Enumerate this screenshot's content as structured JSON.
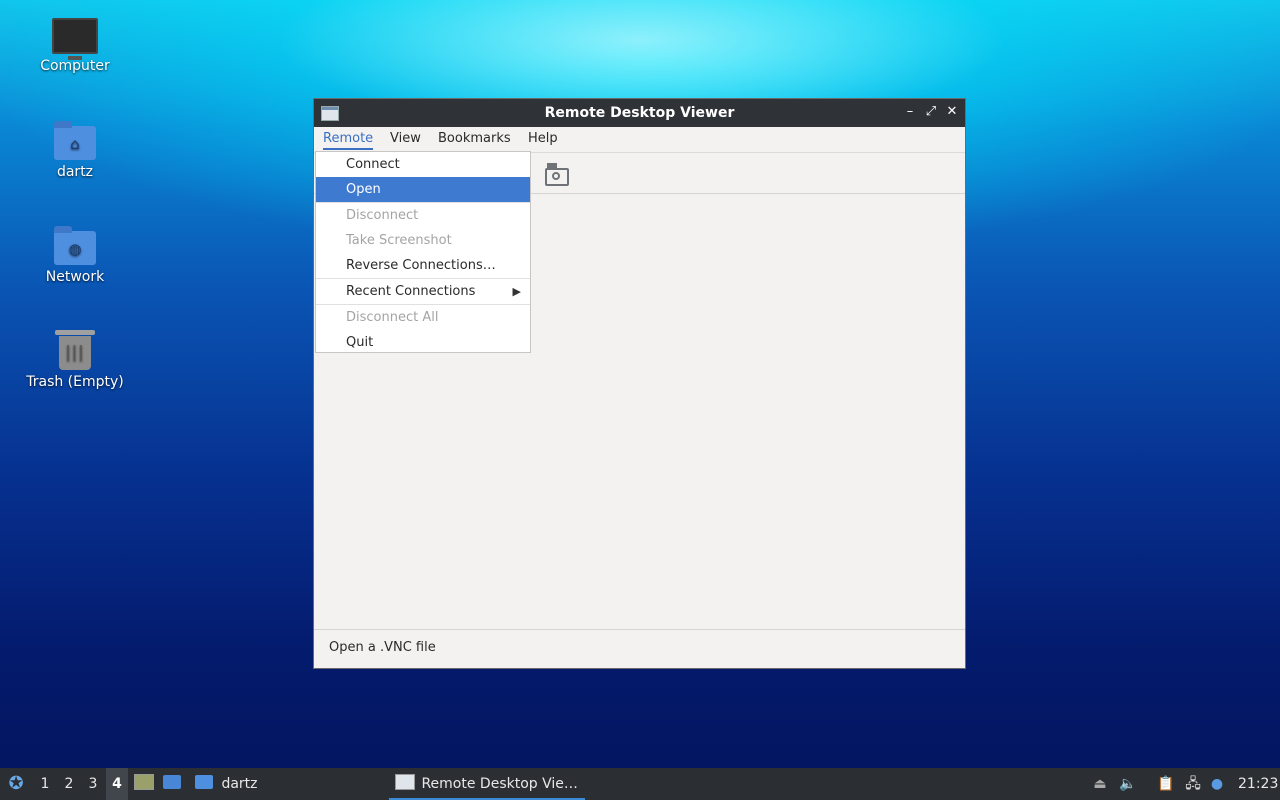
{
  "desktop": {
    "icons": [
      {
        "label": "Computer",
        "icon": "computer-icon"
      },
      {
        "label": "dartz",
        "icon": "home-folder-icon"
      },
      {
        "label": "Network",
        "icon": "network-folder-icon"
      },
      {
        "label": "Trash (Empty)",
        "icon": "trash-icon"
      }
    ]
  },
  "window": {
    "title": "Remote Desktop Viewer",
    "controls": {
      "minimize": "–",
      "maximize": "⤢",
      "close": "✕"
    },
    "menubar": [
      "Remote",
      "View",
      "Bookmarks",
      "Help"
    ],
    "active_menu": "Remote",
    "toolbar": {
      "screenshot_icon": "camera-icon"
    },
    "status": "Open a .VNC file"
  },
  "dropdown": {
    "items": [
      {
        "label": "Connect",
        "state": "normal"
      },
      {
        "label": "Open",
        "state": "selected"
      },
      {
        "label": "Disconnect",
        "state": "disabled"
      },
      {
        "label": "Take Screenshot",
        "state": "disabled"
      },
      {
        "label": "Reverse Connections…",
        "state": "normal"
      },
      {
        "label": "Recent Connections",
        "state": "normal",
        "submenu": true
      },
      {
        "label": "Disconnect All",
        "state": "disabled"
      },
      {
        "label": "Quit",
        "state": "normal"
      }
    ]
  },
  "taskbar": {
    "workspaces": [
      "1",
      "2",
      "3",
      "4"
    ],
    "active_workspace": "4",
    "launcher_folder_label": "dartz",
    "active_task": "Remote Desktop Vie…",
    "clock": "21:23"
  },
  "colors": {
    "selection": "#3e7ad0",
    "titlebar": "#2f3338",
    "taskbar": "#2b2f33",
    "active_menu": "#3a6fc4"
  }
}
